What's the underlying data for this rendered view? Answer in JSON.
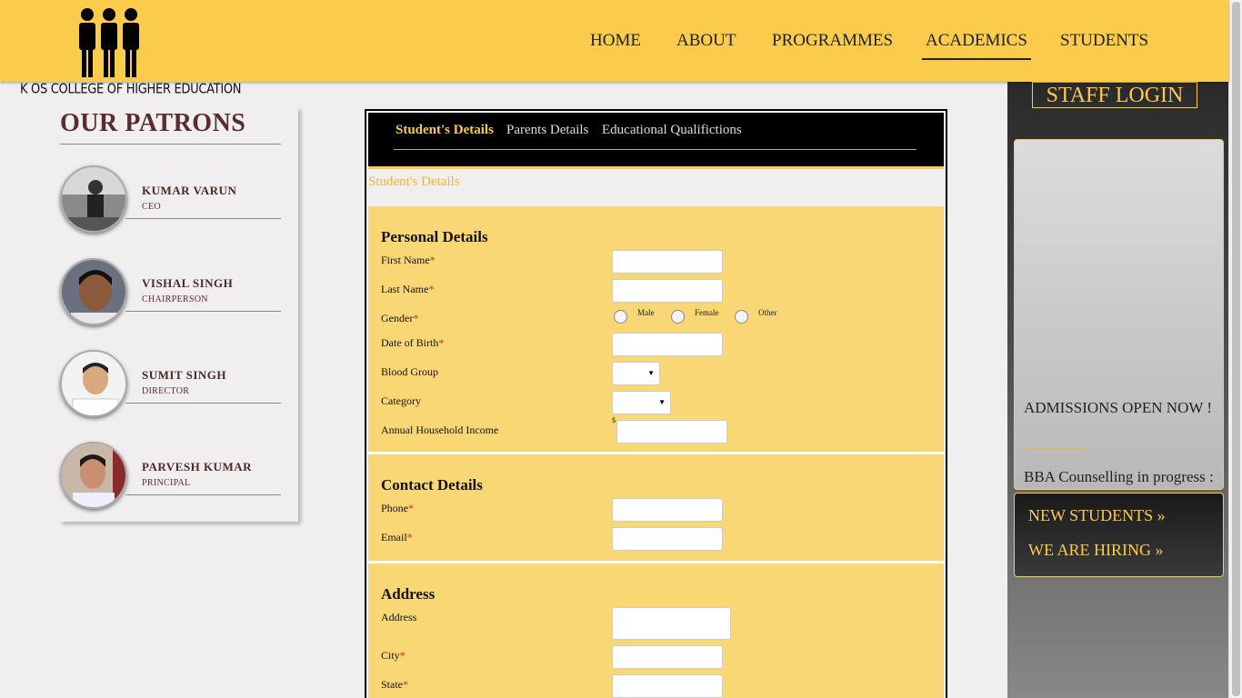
{
  "brand": {
    "logo_icon": "people-group-icon",
    "college_name": "K OS COLLEGE OF HIGHER EDUCATION"
  },
  "nav": [
    "HOME",
    "ABOUT",
    "PROGRAMMES",
    "ACADEMICS",
    "STUDENTS"
  ],
  "nav_active": "ACADEMICS",
  "patrons": {
    "title": "OUR PATRONS",
    "items": [
      {
        "name": "KUMAR VARUN",
        "role": "CEO"
      },
      {
        "name": "VISHAL SINGH",
        "role": "CHAIRPERSON"
      },
      {
        "name": "SUMIT SINGH",
        "role": "DIRECTOR"
      },
      {
        "name": "PARVESH KUMAR",
        "role": "PRINCIPAL"
      }
    ]
  },
  "form": {
    "tabs": [
      "Student's Details",
      "Parents Details",
      "Educational Qualifictions"
    ],
    "active_tab": "Student's Details",
    "section_link": "Student's Details",
    "personal": {
      "title": "Personal Details",
      "first_name": "First Name",
      "last_name": "Last Name",
      "gender": "Gender",
      "gender_options": [
        "Male",
        "Female",
        "Other"
      ],
      "dob": "Date of Birth",
      "blood_group": "Blood Group",
      "category": "Category",
      "income": "Annual Household Income",
      "currency": "$",
      "required_mark": "*"
    },
    "contact": {
      "title": "Contact Details",
      "phone": "Phone",
      "email": "Email"
    },
    "address": {
      "title": "Address",
      "address": "Address",
      "city": "City",
      "state": "State"
    }
  },
  "sidebar": {
    "staff_login": "STAFF LOGIN",
    "news": [
      "ADMISSIONS OPEN NOW !",
      "BBA Counselling in progress :"
    ],
    "links": [
      "NEW STUDENTS »",
      "WE ARE HIRING »"
    ]
  },
  "colors": {
    "header": "#fbcb4b",
    "accent": "#fbcb4b",
    "form_section": "#fad775",
    "patron_text": "#5a2d2d",
    "required": "#dd2222"
  }
}
